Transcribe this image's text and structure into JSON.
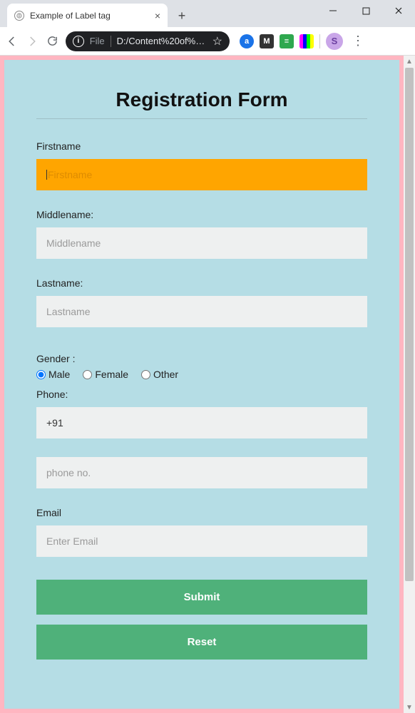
{
  "browser": {
    "tab_title": "Example of Label tag",
    "address_prefix": "File",
    "address_path": "D:/Content%20of%2...",
    "avatar_letter": "S"
  },
  "form": {
    "title": "Registration Form",
    "firstname": {
      "label": "Firstname",
      "placeholder": "Firstname",
      "value": ""
    },
    "middlename": {
      "label": "Middlename:",
      "placeholder": "Middlename",
      "value": ""
    },
    "lastname": {
      "label": "Lastname:",
      "placeholder": "Lastname",
      "value": ""
    },
    "gender": {
      "label": "Gender :",
      "options": [
        "Male",
        "Female",
        "Other"
      ],
      "selected": "Male"
    },
    "phone": {
      "label": "Phone:",
      "country_code": "+91",
      "placeholder": "phone no.",
      "value": ""
    },
    "email": {
      "label": "Email",
      "placeholder": "Enter Email",
      "value": ""
    },
    "buttons": {
      "submit": "Submit",
      "reset": "Reset"
    }
  }
}
